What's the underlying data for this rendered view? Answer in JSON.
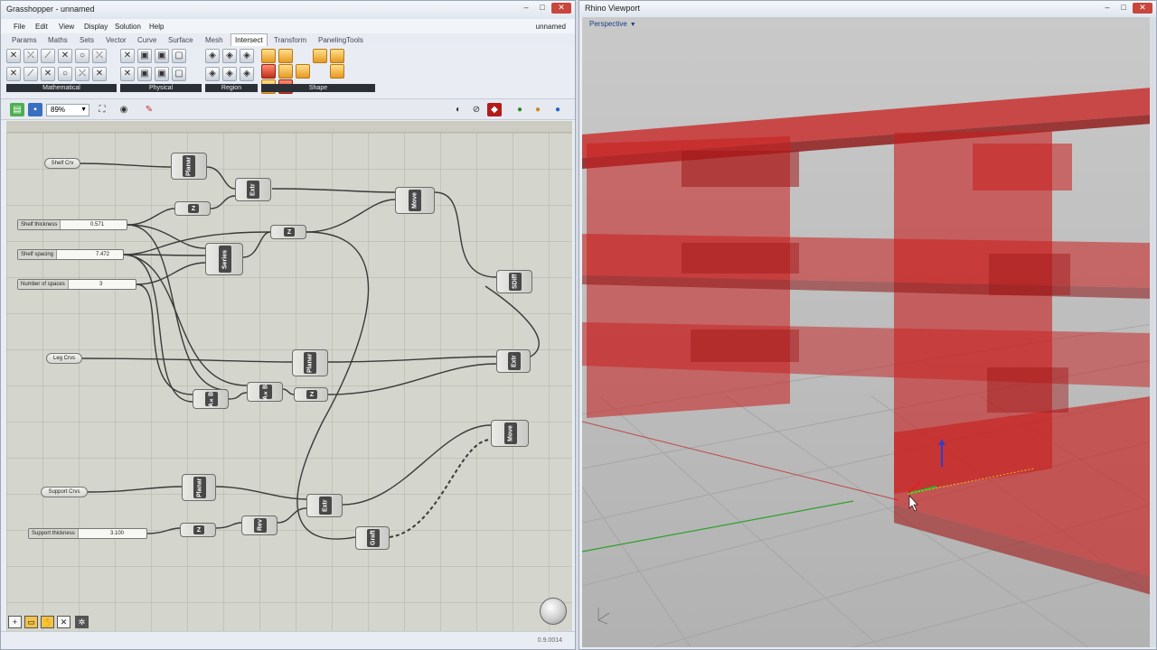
{
  "grasshopper": {
    "title": "Grasshopper - unnamed",
    "doc_name": "unnamed",
    "menu": [
      "File",
      "Edit",
      "View",
      "Display",
      "Solution",
      "Help"
    ],
    "tabs": [
      "Params",
      "Maths",
      "Sets",
      "Vector",
      "Curve",
      "Surface",
      "Mesh",
      "Intersect",
      "Transform",
      "PanelingTools"
    ],
    "active_tab": "Intersect",
    "ribbon_groups": [
      "Mathematical",
      "Physical",
      "Region",
      "Shape"
    ],
    "zoom": "89%",
    "version": "0.9.0014",
    "params": {
      "shelf_crv": "Shelf Crv",
      "leg_crvs": "Leg Crvs",
      "support_crvs": "Support Crvs"
    },
    "sliders": {
      "shelf_thickness": {
        "label": "Shelf thickness",
        "value": "0.571"
      },
      "shelf_spacing": {
        "label": "Shelf spacing",
        "value": "7.472"
      },
      "number_of_spaces": {
        "label": "Number of spaces",
        "value": "3"
      },
      "support_thickness": {
        "label": "Support thickness",
        "value": "3.100"
      }
    },
    "components": {
      "planar1": "Planar",
      "extr1": "Extr",
      "move1": "Move",
      "z1": "Z",
      "z2": "Z",
      "series": "Series",
      "sdiff": "SDiff",
      "planar2": "Planar",
      "extr2": "Extr",
      "axb1": "A×B",
      "axb2": "A×B",
      "z3": "Z",
      "move2": "Move",
      "planar3": "Planar",
      "extr3": "Extr",
      "z4": "Z",
      "rev": "Rev",
      "graft": "Graft"
    }
  },
  "rhino": {
    "title": "Rhino Viewport",
    "view_name": "Perspective"
  },
  "colors": {
    "shelf_red": "#c81e1e",
    "grid": "#a6a6a6",
    "x_axis": "#c04040",
    "y_axis": "#30a030"
  }
}
